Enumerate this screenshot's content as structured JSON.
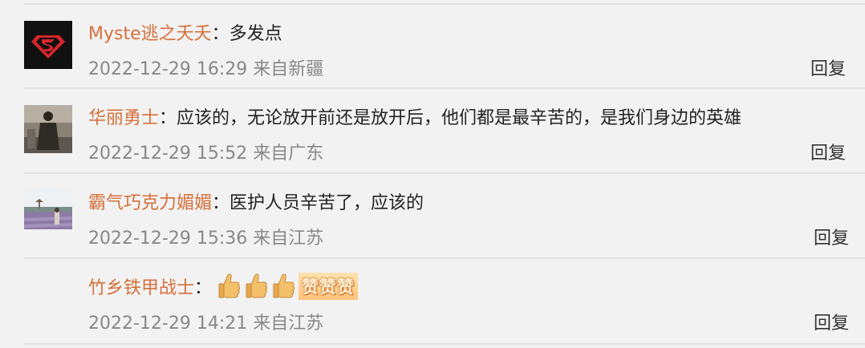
{
  "comments": [
    {
      "username": "Myste逃之夭夭",
      "colon": "：",
      "text": "多发点",
      "meta": "2022-12-29 16:29 来自新疆",
      "reply_label": "回复",
      "avatar": "superman-logo-avatar"
    },
    {
      "username": "华丽勇士",
      "colon": "：",
      "text": "应该的，无论放开前还是放开后，他们都是最辛苦的，是我们身边的英雄",
      "meta": "2022-12-29 15:52 来自广东",
      "reply_label": "回复",
      "avatar": "person-in-coat-avatar"
    },
    {
      "username": "霸气巧克力媚媚",
      "colon": "：",
      "text": "医护人员辛苦了，应该的",
      "meta": "2022-12-29 15:36 来自江苏",
      "reply_label": "回复",
      "avatar": "lavender-field-avatar"
    },
    {
      "username": "竹乡铁甲战士",
      "colon": "：",
      "emoji": [
        "thumbs-up-icon",
        "thumbs-up-icon",
        "thumbs-up-icon"
      ],
      "sticker_text": "赞赞赞",
      "meta": "2022-12-29 14:21 来自江苏",
      "reply_label": "回复",
      "avatar": ""
    }
  ],
  "colors": {
    "username": "#d5703a",
    "meta": "#888888",
    "background": "#f2f2f2",
    "separator": "#e2e2e2"
  }
}
